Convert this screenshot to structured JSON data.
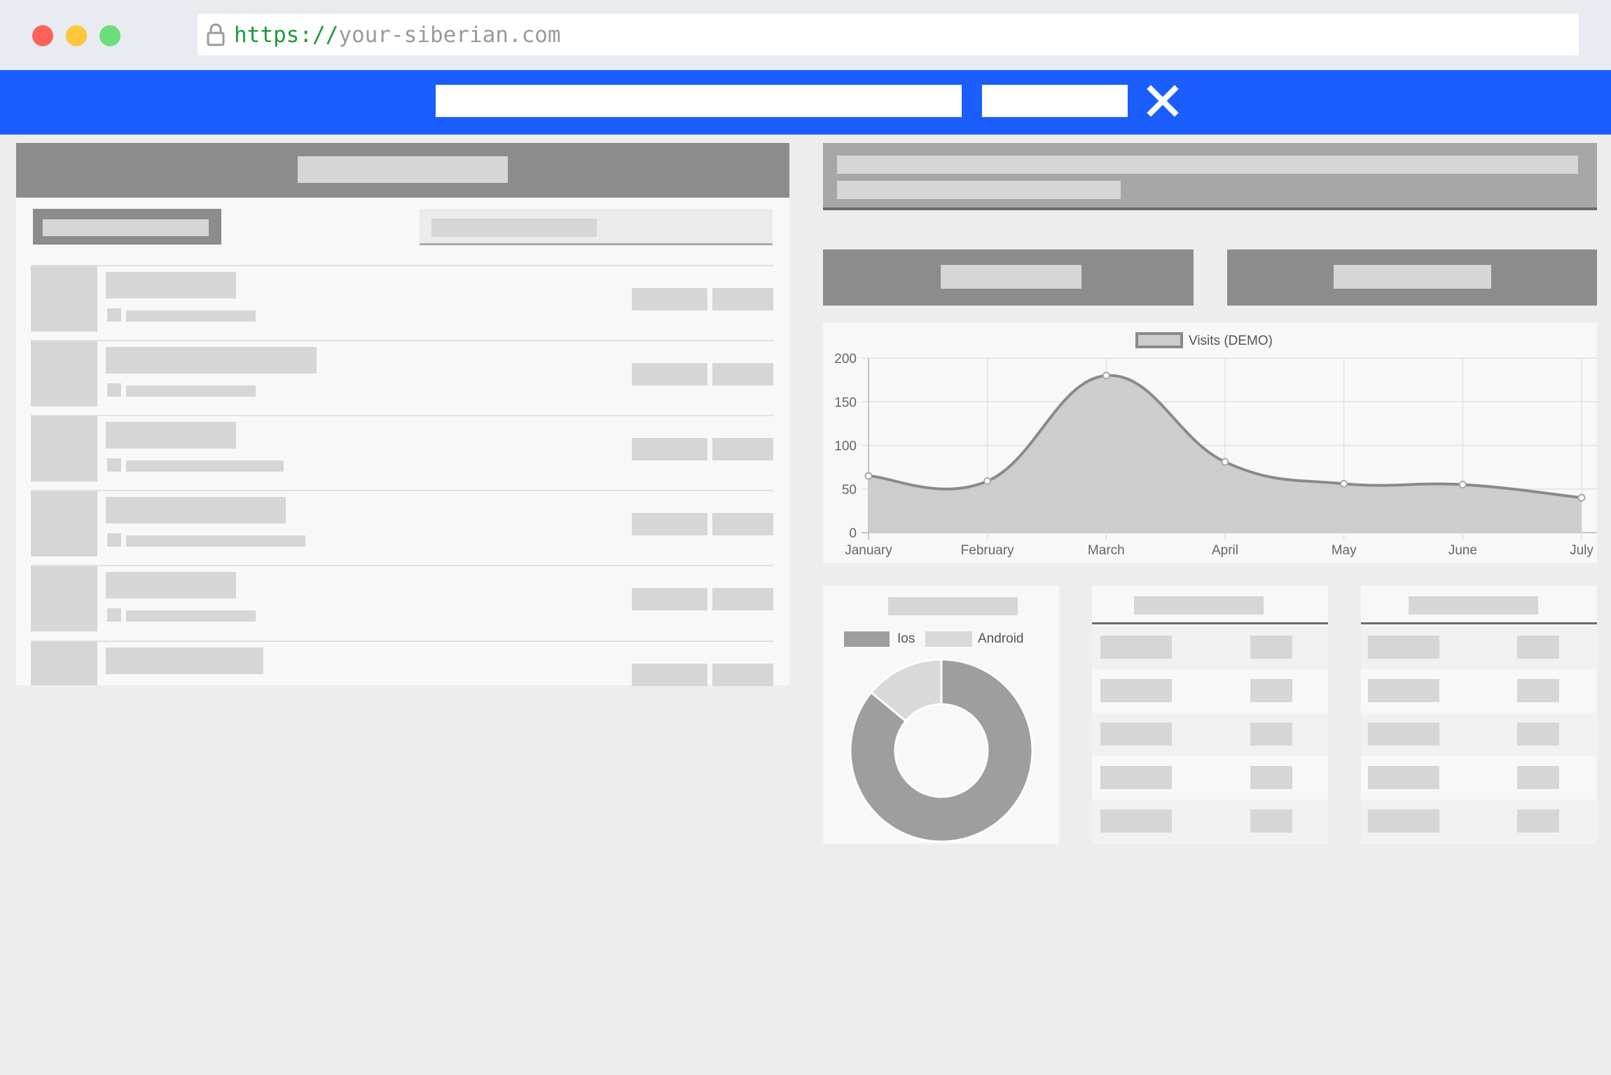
{
  "browser": {
    "traffic_lights": [
      "#fe605c",
      "#fec63d",
      "#6ade7a"
    ],
    "url_protocol": "https://",
    "url_host": "your-siberian.com"
  },
  "toolbar": {
    "accent": "#1a5ffe"
  },
  "chart_data": {
    "type": "line",
    "categories": [
      "January",
      "February",
      "March",
      "April",
      "May",
      "June",
      "July"
    ],
    "series": [
      {
        "name": "Visits (DEMO)",
        "values": [
          65,
          59,
          180,
          81,
          56,
          55,
          40
        ]
      }
    ],
    "ylim": [
      0,
      200
    ],
    "yticks": [
      "0",
      "50",
      "100",
      "150",
      "200"
    ],
    "legend": "top-center",
    "grid": true,
    "fill": true
  },
  "donut": {
    "type": "pie",
    "labels": [
      "Ios",
      "Android"
    ],
    "values": [
      86,
      14
    ],
    "colors": [
      "#9e9e9e",
      "#d9d9d9"
    ],
    "legend": "top"
  }
}
